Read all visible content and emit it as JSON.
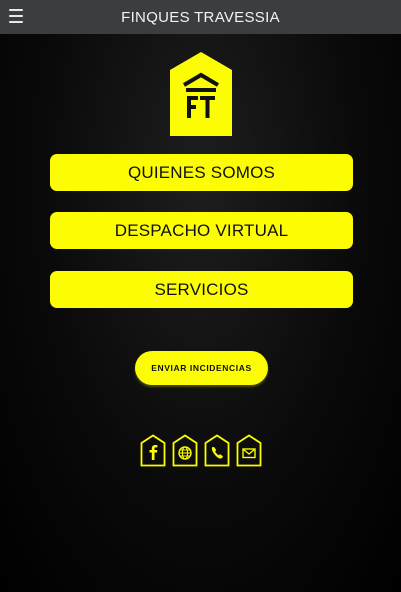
{
  "header": {
    "title": "FINQUES TRAVESSIA",
    "menu_icon": "hamburger-menu-icon"
  },
  "logo": {
    "icon": "finques-travessia-logo",
    "color": "#fcfc02"
  },
  "nav": [
    {
      "label": "QUIENES SOMOS"
    },
    {
      "label": "DESPACHO VIRTUAL"
    },
    {
      "label": "SERVICIOS"
    }
  ],
  "incidencias": {
    "label": "ENVIAR INCIDENCIAS"
  },
  "social": [
    {
      "icon": "facebook-icon"
    },
    {
      "icon": "globe-icon"
    },
    {
      "icon": "phone-icon"
    },
    {
      "icon": "email-icon"
    }
  ],
  "colors": {
    "accent": "#fcfc02",
    "topbar": "#3b3d41",
    "background": "#000000"
  }
}
